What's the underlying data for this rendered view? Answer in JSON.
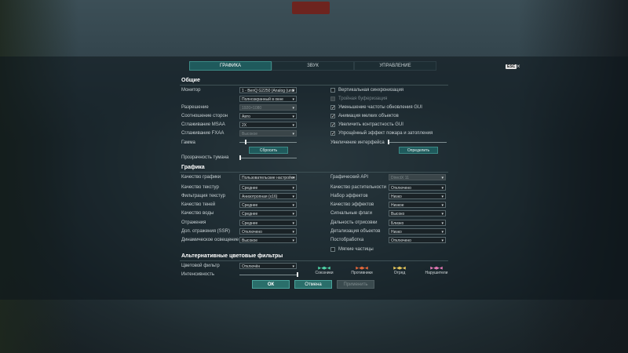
{
  "tabs": [
    "ГРАФИКА",
    "ЗВУК",
    "УПРАВЛЕНИЕ"
  ],
  "esc_label": "ESC",
  "close_glyph": "×",
  "general": {
    "title": "Общие",
    "monitor_label": "Монитор",
    "monitor_value": "1 - BenQ G2250 (Analog (until",
    "mode_value": "Полноэкранный в окне",
    "resolution_label": "Разрешение",
    "resolution_value": "1920×1080",
    "aspect_label": "Соотношение сторон",
    "aspect_value": "Авто",
    "msaa_label": "Сглаживание MSAA",
    "msaa_value": "2X",
    "fxaa_label": "Сглаживание FXAA",
    "fxaa_value": "Высокое",
    "gamma_label": "Гамма",
    "gamma_level": 0.1,
    "reset_label": "Сбросить",
    "fog_label": "Прозрачность тумана",
    "fog_level": 0.0,
    "vsync_label": "Вертикальная синхронизация",
    "triple_label": "Тройная буферизация",
    "gui_freq_label": "Уменьшение частоты обновления GUI",
    "small_anim_label": "Анимация мелких объектов",
    "contrast_label": "Увеличить контрастность GUI",
    "fire_label": "Упрощённый эффект пожара и затопления",
    "ui_scale_label": "Увеличение интерфейса",
    "ui_scale_level": 0.0,
    "detect_label": "Определить"
  },
  "graphics": {
    "title": "Графика",
    "left": [
      {
        "label": "Качество графики",
        "value": "Пользовательские настройки"
      },
      {
        "label": "Качество текстур",
        "value": "Среднее"
      },
      {
        "label": "Фильтрация текстур",
        "value": "Анизотропная (x16)"
      },
      {
        "label": "Качество теней",
        "value": "Среднее"
      },
      {
        "label": "Качество воды",
        "value": "Среднее"
      },
      {
        "label": "Отражения",
        "value": "Среднее"
      },
      {
        "label": "Доп. отражения (SSR)",
        "value": "Отключено"
      },
      {
        "label": "Динамическое освещение",
        "value": "Высокое"
      }
    ],
    "right": [
      {
        "label": "Графический API",
        "value": "DirectX 11"
      },
      {
        "label": "Качество растительности",
        "value": "Отключено"
      },
      {
        "label": "Набор эффектов",
        "value": "Низко"
      },
      {
        "label": "Качество эффектов",
        "value": "Низкое"
      },
      {
        "label": "Сигнальные флаги",
        "value": "Высоко"
      },
      {
        "label": "Дальность отрисовки",
        "value": "Близко"
      },
      {
        "label": "Детализация объектов",
        "value": "Низко"
      },
      {
        "label": "Постобработка",
        "value": "Отключено"
      }
    ],
    "soft_particles_label": "Мягкие частицы"
  },
  "filters": {
    "title": "Альтернативные цветовые фильтры",
    "color_filter_label": "Цветовой фильтр",
    "color_filter_value": "Отключён",
    "intensity_label": "Интенсивность",
    "intensity_level": 1.0,
    "legend": [
      {
        "name": "Союзники",
        "color": "#4fd6a8"
      },
      {
        "name": "Противники",
        "color": "#e8683a"
      },
      {
        "name": "Отряд",
        "color": "#e8c85a"
      },
      {
        "name": "Нарушители",
        "color": "#e87ab8"
      }
    ]
  },
  "buttons": {
    "ok": "ОК",
    "cancel": "Отмена",
    "apply": "Применить"
  },
  "colors": {
    "accent": "#1f5a5c",
    "panel": "#1a2226"
  }
}
